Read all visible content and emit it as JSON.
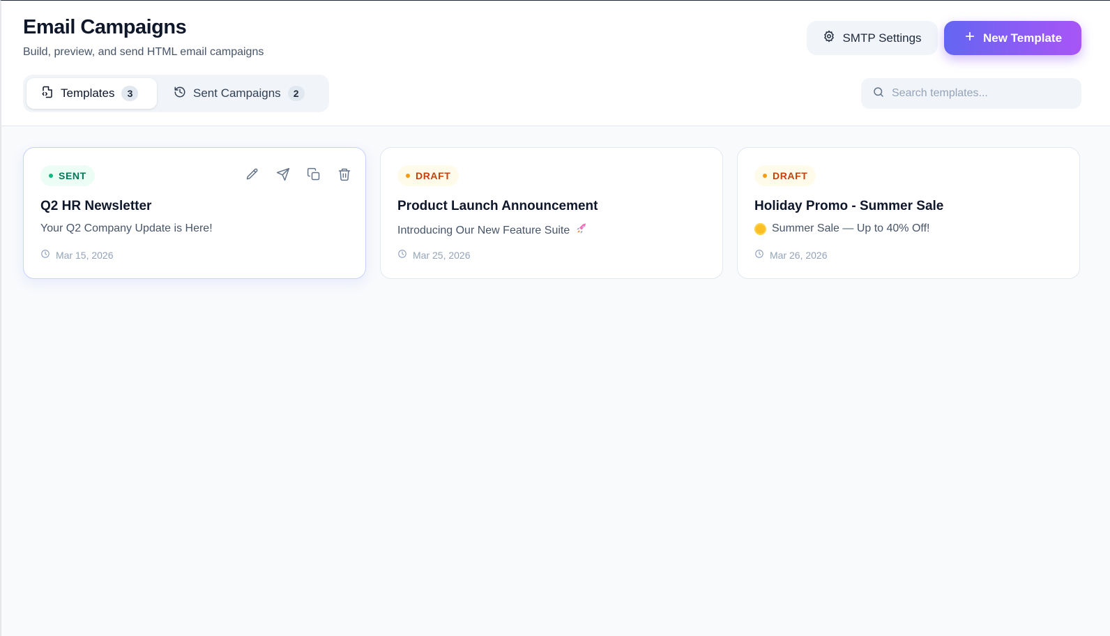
{
  "header": {
    "title": "Email Campaigns",
    "subtitle": "Build, preview, and send HTML email campaigns",
    "smtp_label": "SMTP Settings",
    "new_template_label": "New Template"
  },
  "tabs": [
    {
      "label": "Templates",
      "count": "3",
      "icon": "file-code-icon",
      "active": true
    },
    {
      "label": "Sent Campaigns",
      "count": "2",
      "icon": "history-icon",
      "active": false
    }
  ],
  "search": {
    "placeholder": "Search templates...",
    "value": ""
  },
  "cards": [
    {
      "status": "SENT",
      "title": "Q2 HR Newsletter",
      "subject": "Your Q2 Company Update is Here!",
      "subject_emoji": "",
      "date": "Mar 15, 2026",
      "actions": [
        "edit-icon",
        "send-icon",
        "copy-icon",
        "trash-icon"
      ]
    },
    {
      "status": "DRAFT",
      "title": "Product Launch Announcement",
      "subject": "Introducing Our New Feature Suite",
      "subject_emoji": "🚀",
      "date": "Mar 25, 2026"
    },
    {
      "status": "DRAFT",
      "title": "Holiday Promo - Summer Sale",
      "subject": "Summer Sale — Up to 40% Off!",
      "subject_emoji": "☀",
      "date": "Mar 26, 2026"
    }
  ],
  "colors": {
    "accent_start": "#6366f1",
    "accent_end": "#a855f7",
    "sent_text": "#047857",
    "sent_bg": "#ecfdf5",
    "draft_text": "#c2410c",
    "draft_bg": "#fffbeb",
    "page_bg": "#f8fafc"
  }
}
